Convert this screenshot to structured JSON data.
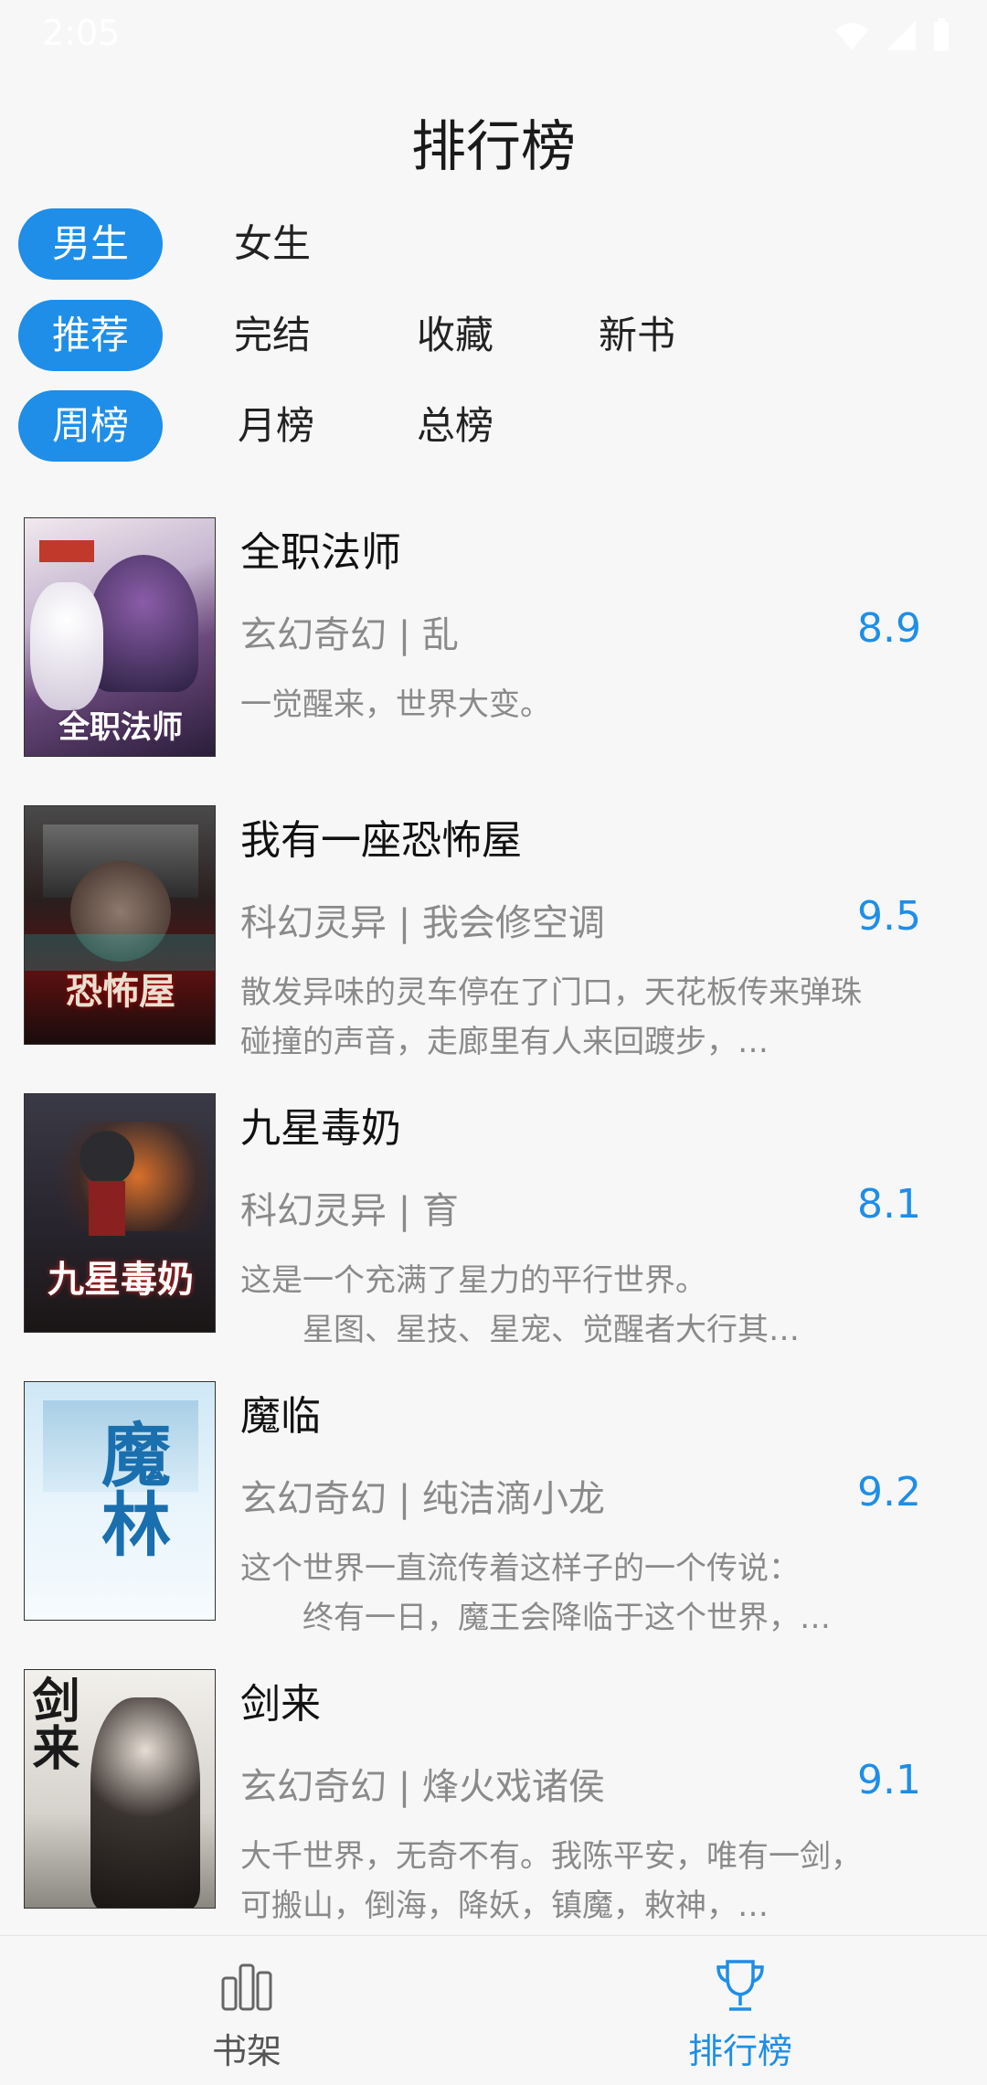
{
  "status_bar": {
    "time": "2:05"
  },
  "header": {
    "title": "排行榜"
  },
  "filters": {
    "gender": [
      {
        "label": "男生",
        "active": true
      },
      {
        "label": "女生",
        "active": false
      }
    ],
    "category": [
      {
        "label": "推荐",
        "active": true
      },
      {
        "label": "完结",
        "active": false
      },
      {
        "label": "收藏",
        "active": false
      },
      {
        "label": "新书",
        "active": false
      }
    ],
    "period": [
      {
        "label": "周榜",
        "active": true
      },
      {
        "label": "月榜",
        "active": false
      },
      {
        "label": "总榜",
        "active": false
      }
    ]
  },
  "books": [
    {
      "title": "全职法师",
      "meta": "玄幻奇幻 | 乱",
      "score": "8.9",
      "description": "一觉醒来，世界大变。",
      "cover_text": "全职法师"
    },
    {
      "title": "我有一座恐怖屋",
      "meta": "科幻灵异 | 我会修空调",
      "score": "9.5",
      "description": "散发异味的灵车停在了门口，天花板传来弹珠碰撞的声音，走廊里有人来回踱步，…",
      "cover_text": "恐怖屋"
    },
    {
      "title": "九星毒奶",
      "meta": "科幻灵异 | 育",
      "score": "8.1",
      "description": "这是一个充满了星力的平行世界。\n　　星图、星技、星宠、觉醒者大行其…",
      "cover_text": "九星毒奶"
    },
    {
      "title": "魔临",
      "meta": "玄幻奇幻 | 纯洁滴小龙",
      "score": "9.2",
      "description": "这个世界一直流传着这样子的一个传说：\n　　终有一日，魔王会降临于这个世界，…",
      "cover_text": "魔林"
    },
    {
      "title": "剑来",
      "meta": "玄幻奇幻 | 烽火戏诸侯",
      "score": "9.1",
      "description": "大千世界，无奇不有。我陈平安，唯有一剑，可搬山，倒海，降妖，镇魔，敕神，…",
      "cover_text": "剑来"
    }
  ],
  "bottom_nav": [
    {
      "label": "书架",
      "icon": "bookshelf-icon",
      "active": false
    },
    {
      "label": "排行榜",
      "icon": "trophy-icon",
      "active": true
    }
  ],
  "colors": {
    "accent": "#1e8ee8",
    "text_secondary": "#8a8a8a",
    "background": "#f7f7f7"
  }
}
